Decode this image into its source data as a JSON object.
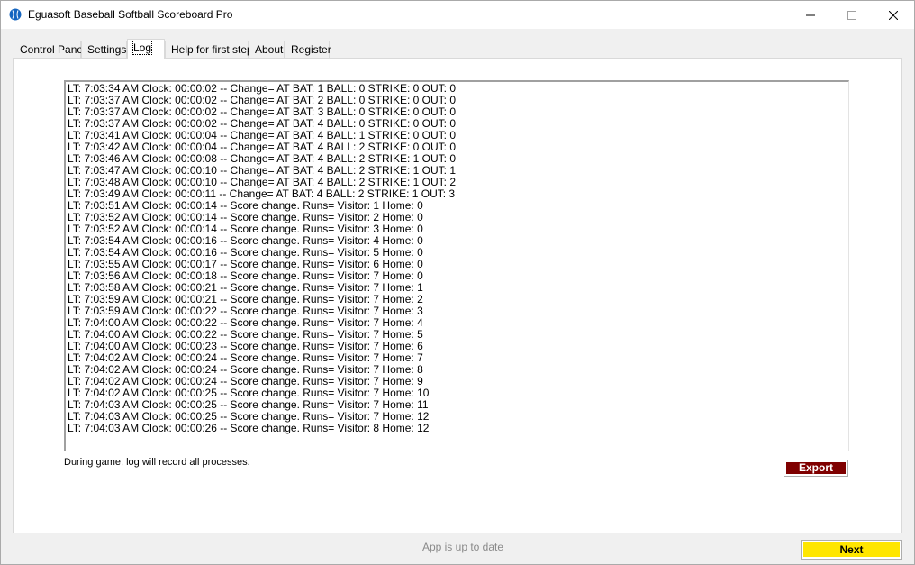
{
  "window": {
    "title": "Eguasoft Baseball Softball Scoreboard Pro",
    "controls": {
      "minimize": "—",
      "maximize": "☐",
      "close": "✕"
    }
  },
  "tabs": [
    {
      "label": "Control Panel"
    },
    {
      "label": "Settings"
    },
    {
      "label": "Log",
      "active": true
    },
    {
      "label": "Help for first step"
    },
    {
      "label": "About"
    },
    {
      "label": "Register"
    }
  ],
  "log": {
    "lines": [
      "LT: 7:03:34 AM Clock: 00:00:02 -- Change= AT BAT: 1 BALL: 0 STRIKE: 0 OUT: 0",
      "LT: 7:03:37 AM Clock: 00:00:02 -- Change= AT BAT: 2 BALL: 0 STRIKE: 0 OUT: 0",
      "LT: 7:03:37 AM Clock: 00:00:02 -- Change= AT BAT: 3 BALL: 0 STRIKE: 0 OUT: 0",
      "LT: 7:03:37 AM Clock: 00:00:02 -- Change= AT BAT: 4 BALL: 0 STRIKE: 0 OUT: 0",
      "LT: 7:03:41 AM Clock: 00:00:04 -- Change= AT BAT: 4 BALL: 1 STRIKE: 0 OUT: 0",
      "LT: 7:03:42 AM Clock: 00:00:04 -- Change= AT BAT: 4 BALL: 2 STRIKE: 0 OUT: 0",
      "LT: 7:03:46 AM Clock: 00:00:08 -- Change= AT BAT: 4 BALL: 2 STRIKE: 1 OUT: 0",
      "LT: 7:03:47 AM Clock: 00:00:10 -- Change= AT BAT: 4 BALL: 2 STRIKE: 1 OUT: 1",
      "LT: 7:03:48 AM Clock: 00:00:10 -- Change= AT BAT: 4 BALL: 2 STRIKE: 1 OUT: 2",
      "LT: 7:03:49 AM Clock: 00:00:11 -- Change= AT BAT: 4 BALL: 2 STRIKE: 1 OUT: 3",
      "LT: 7:03:51 AM Clock: 00:00:14 -- Score change. Runs= Visitor: 1 Home: 0",
      "LT: 7:03:52 AM Clock: 00:00:14 -- Score change. Runs= Visitor: 2 Home: 0",
      "LT: 7:03:52 AM Clock: 00:00:14 -- Score change. Runs= Visitor: 3 Home: 0",
      "LT: 7:03:54 AM Clock: 00:00:16 -- Score change. Runs= Visitor: 4 Home: 0",
      "LT: 7:03:54 AM Clock: 00:00:16 -- Score change. Runs= Visitor: 5 Home: 0",
      "LT: 7:03:55 AM Clock: 00:00:17 -- Score change. Runs= Visitor: 6 Home: 0",
      "LT: 7:03:56 AM Clock: 00:00:18 -- Score change. Runs= Visitor: 7 Home: 0",
      "LT: 7:03:58 AM Clock: 00:00:21 -- Score change. Runs= Visitor: 7 Home: 1",
      "LT: 7:03:59 AM Clock: 00:00:21 -- Score change. Runs= Visitor: 7 Home: 2",
      "LT: 7:03:59 AM Clock: 00:00:22 -- Score change. Runs= Visitor: 7 Home: 3",
      "LT: 7:04:00 AM Clock: 00:00:22 -- Score change. Runs= Visitor: 7 Home: 4",
      "LT: 7:04:00 AM Clock: 00:00:22 -- Score change. Runs= Visitor: 7 Home: 5",
      "LT: 7:04:00 AM Clock: 00:00:23 -- Score change. Runs= Visitor: 7 Home: 6",
      "LT: 7:04:02 AM Clock: 00:00:24 -- Score change. Runs= Visitor: 7 Home: 7",
      "LT: 7:04:02 AM Clock: 00:00:24 -- Score change. Runs= Visitor: 7 Home: 8",
      "LT: 7:04:02 AM Clock: 00:00:24 -- Score change. Runs= Visitor: 7 Home: 9",
      "LT: 7:04:02 AM Clock: 00:00:25 -- Score change. Runs= Visitor: 7 Home: 10",
      "LT: 7:04:03 AM Clock: 00:00:25 -- Score change. Runs= Visitor: 7 Home: 11",
      "LT: 7:04:03 AM Clock: 00:00:25 -- Score change. Runs= Visitor: 7 Home: 12",
      "LT: 7:04:03 AM Clock: 00:00:26 -- Score change. Runs= Visitor: 8 Home: 12"
    ]
  },
  "hint": "During game, log will record all processes.",
  "export_label": "Export",
  "status_text": "App is up to date",
  "next_label": "Next",
  "colors": {
    "export_bg": "#7f0000",
    "next_bg": "#ffe600",
    "app_icon": "#1565c0"
  },
  "icons": {
    "app": "baseball-icon",
    "minimize": "minimize-icon",
    "maximize": "maximize-icon",
    "close": "close-icon"
  }
}
